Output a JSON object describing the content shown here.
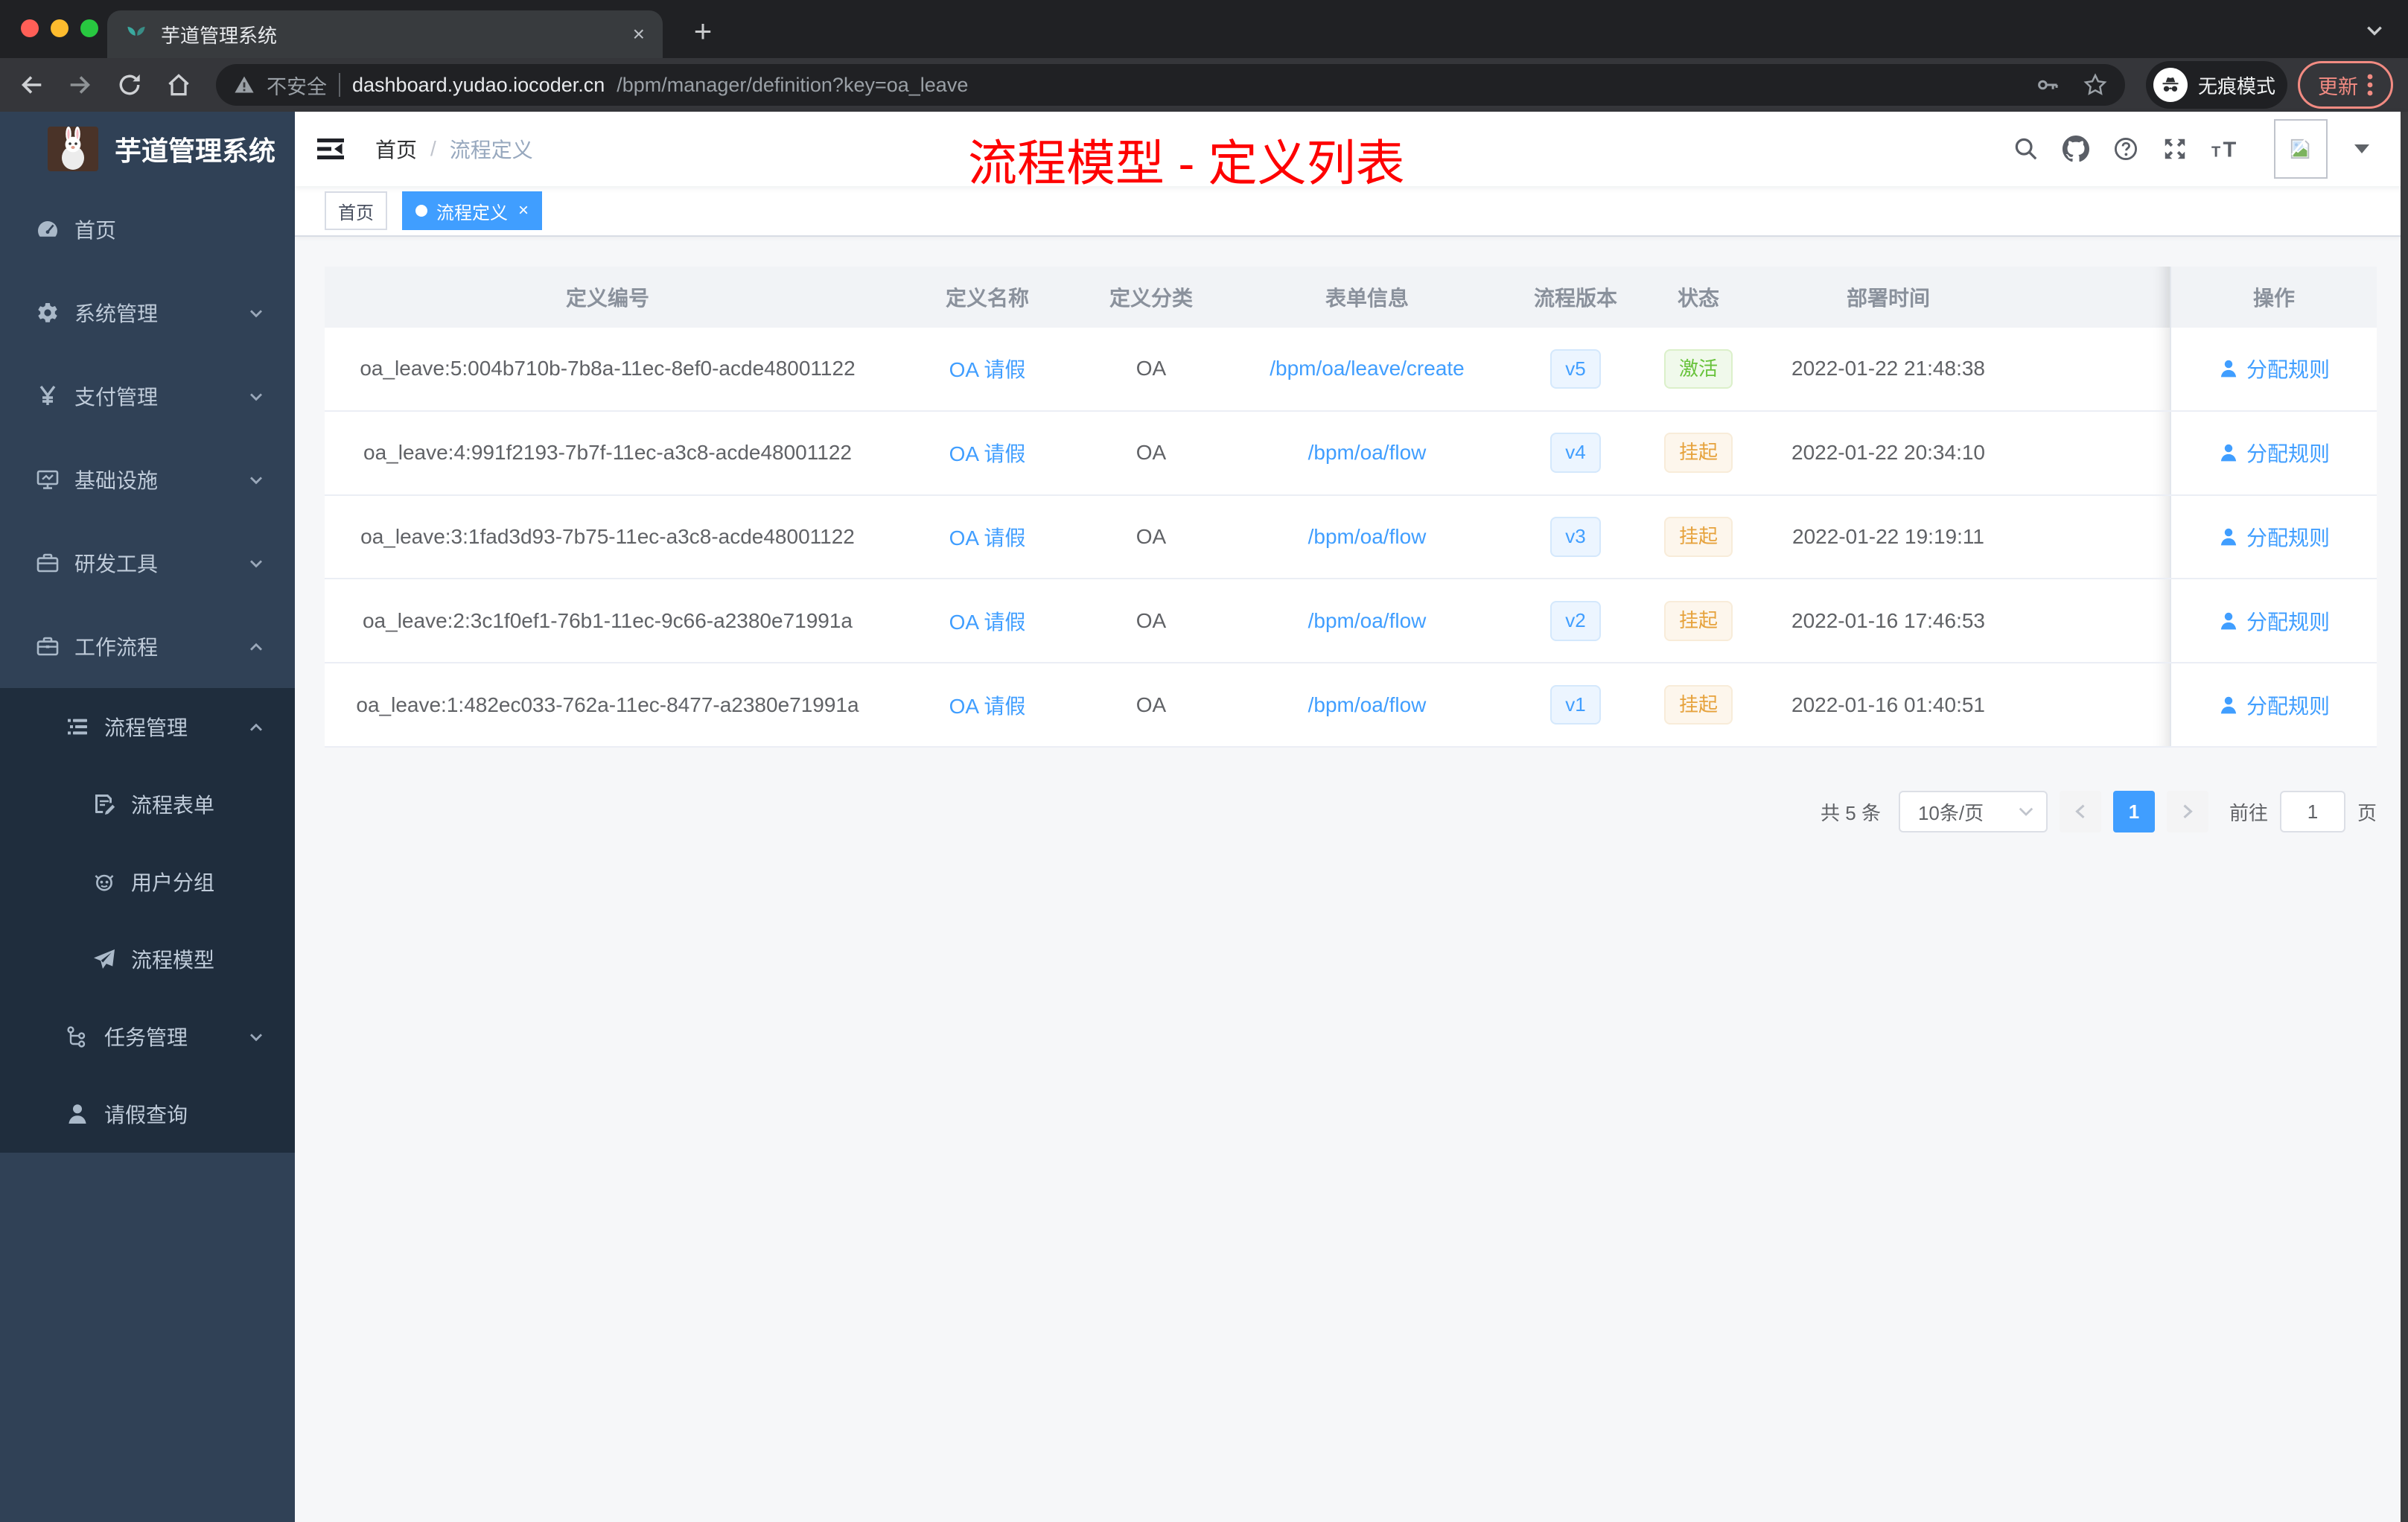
{
  "colors": {
    "accent": "#409eff",
    "success": "#67c23a",
    "warning": "#e6a23c",
    "annotation_red": "#fe0100",
    "sidebar_bg": "#304156",
    "submenu_bg": "#1f2d3d"
  },
  "browser": {
    "tab_title": "芋道管理系统",
    "security": "不安全",
    "url_host": "dashboard.yudao.iocoder.cn",
    "url_path": "/bpm/manager/definition?key=oa_leave",
    "incognito": "无痕模式",
    "update": "更新",
    "close": "×",
    "new_tab": "+"
  },
  "sidebar": {
    "title": "芋道管理系统",
    "items": [
      {
        "key": "home",
        "label": "首页",
        "icon": "dashboard-icon",
        "level": 1
      },
      {
        "key": "system-management",
        "label": "系统管理",
        "icon": "gear-icon",
        "level": 1,
        "chevron": "down"
      },
      {
        "key": "payment-management",
        "label": "支付管理",
        "icon": "yen-icon",
        "level": 1,
        "chevron": "down"
      },
      {
        "key": "infrastructure",
        "label": "基础设施",
        "icon": "monitor-icon",
        "level": 1,
        "chevron": "down"
      },
      {
        "key": "dev-tools",
        "label": "研发工具",
        "icon": "toolbox-icon",
        "level": 1,
        "chevron": "down"
      },
      {
        "key": "workflow",
        "label": "工作流程",
        "icon": "briefcase-icon",
        "level": 1,
        "chevron": "up"
      },
      {
        "key": "process-management",
        "label": "流程管理",
        "icon": "list-icon",
        "level": 2,
        "chevron": "up",
        "submenu": true
      },
      {
        "key": "process-form",
        "label": "流程表单",
        "icon": "form-icon",
        "level": 3,
        "submenu": true
      },
      {
        "key": "user-group",
        "label": "用户分组",
        "icon": "robot-icon",
        "level": 3,
        "submenu": true
      },
      {
        "key": "process-model",
        "label": "流程模型",
        "icon": "paper-plane-icon",
        "level": 3,
        "submenu": true
      },
      {
        "key": "task-management",
        "label": "任务管理",
        "icon": "tree-icon",
        "level": 2,
        "chevron": "down",
        "submenu": true
      },
      {
        "key": "leave-query",
        "label": "请假查询",
        "icon": "user-icon",
        "level": 2,
        "submenu": true
      }
    ]
  },
  "navbar": {
    "breadcrumb_home": "首页",
    "breadcrumb_separator": "/",
    "breadcrumb_current": "流程定义",
    "annotation": "流程模型 - 定义列表"
  },
  "tags": [
    {
      "label": "首页",
      "active": false
    },
    {
      "label": "流程定义",
      "active": true
    }
  ],
  "table": {
    "columns": [
      "定义编号",
      "定义名称",
      "定义分类",
      "表单信息",
      "流程版本",
      "状态",
      "部署时间",
      "操作"
    ],
    "action_label": "分配规则",
    "rows": [
      {
        "id": "oa_leave:5:004b710b-7b8a-11ec-8ef0-acde48001122",
        "name": "OA 请假",
        "category": "OA",
        "form": "/bpm/oa/leave/create",
        "version": "v5",
        "status": "激活",
        "status_type": "success",
        "deployed": "2022-01-22 21:48:38"
      },
      {
        "id": "oa_leave:4:991f2193-7b7f-11ec-a3c8-acde48001122",
        "name": "OA 请假",
        "category": "OA",
        "form": "/bpm/oa/flow",
        "version": "v4",
        "status": "挂起",
        "status_type": "warning",
        "deployed": "2022-01-22 20:34:10"
      },
      {
        "id": "oa_leave:3:1fad3d93-7b75-11ec-a3c8-acde48001122",
        "name": "OA 请假",
        "category": "OA",
        "form": "/bpm/oa/flow",
        "version": "v3",
        "status": "挂起",
        "status_type": "warning",
        "deployed": "2022-01-22 19:19:11"
      },
      {
        "id": "oa_leave:2:3c1f0ef1-76b1-11ec-9c66-a2380e71991a",
        "name": "OA 请假",
        "category": "OA",
        "form": "/bpm/oa/flow",
        "version": "v2",
        "status": "挂起",
        "status_type": "warning",
        "deployed": "2022-01-16 17:46:53"
      },
      {
        "id": "oa_leave:1:482ec033-762a-11ec-8477-a2380e71991a",
        "name": "OA 请假",
        "category": "OA",
        "form": "/bpm/oa/flow",
        "version": "v1",
        "status": "挂起",
        "status_type": "warning",
        "deployed": "2022-01-16 01:40:51"
      }
    ]
  },
  "pagination": {
    "total": "共 5 条",
    "page_size": "10条/页",
    "page": "1",
    "goto": "前往",
    "goto_value": "1",
    "unit": "页"
  }
}
